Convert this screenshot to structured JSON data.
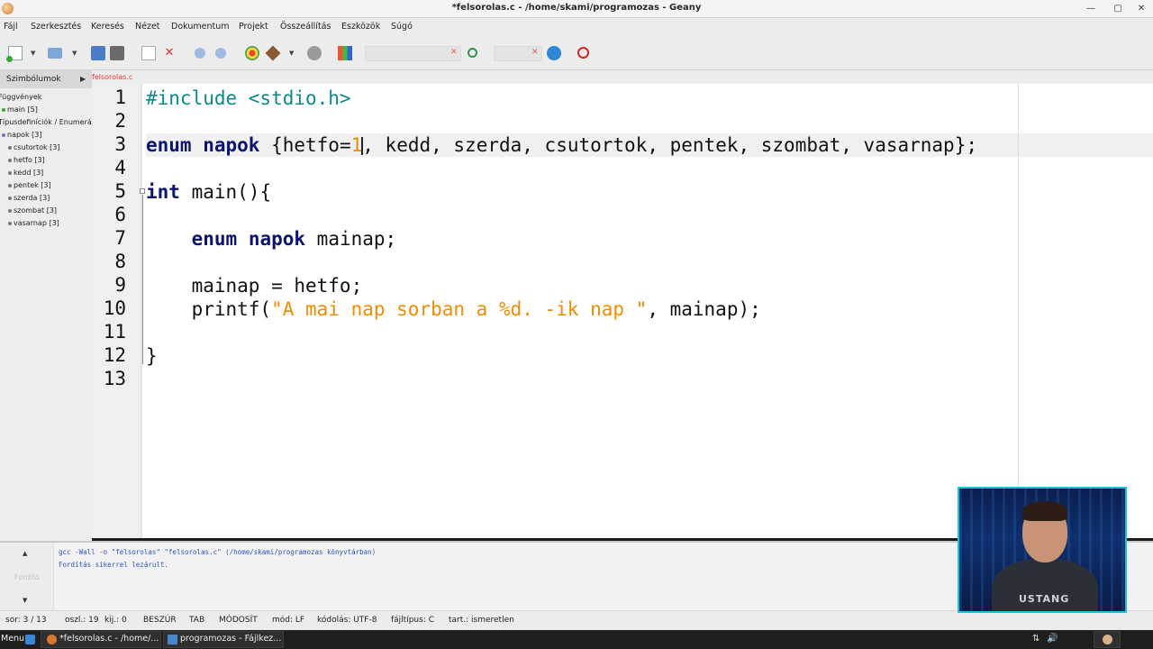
{
  "window": {
    "title": "*felsorolas.c - /home/skami/programozas - Geany",
    "controls": {
      "minimize": "—",
      "maximize": "▢",
      "close": "✕"
    }
  },
  "menu": [
    "Fájl",
    "Szerkesztés",
    "Keresés",
    "Nézet",
    "Dokumentum",
    "Projekt",
    "Összeállítás",
    "Eszközök",
    "Súgó"
  ],
  "toolbar": {
    "icons": [
      "new-file-icon",
      "open-file-icon",
      "save-icon",
      "save-all-icon",
      "revert-icon",
      "close-icon",
      "back-icon",
      "forward-icon",
      "compile-icon",
      "build-icon",
      "run-icon",
      "color-chooser-icon",
      "search-icon",
      "jump-to-line-icon",
      "quit-icon"
    ],
    "search_value": "",
    "goto_value": ""
  },
  "sidebar": {
    "tab_label": "Szimbólumok",
    "symbols": [
      {
        "label": "Függvények",
        "indent": 0,
        "kind": "group"
      },
      {
        "label": "main [5]",
        "indent": 1,
        "kind": "fn"
      },
      {
        "label": "Típusdefiníciók / Enumerá",
        "indent": 0,
        "kind": "group"
      },
      {
        "label": "napok [3]",
        "indent": 1,
        "kind": "en"
      },
      {
        "label": "csutortok [3]",
        "indent": 2,
        "kind": "mem"
      },
      {
        "label": "hetfo [3]",
        "indent": 2,
        "kind": "mem"
      },
      {
        "label": "kedd [3]",
        "indent": 2,
        "kind": "mem"
      },
      {
        "label": "pentek [3]",
        "indent": 2,
        "kind": "mem"
      },
      {
        "label": "szerda [3]",
        "indent": 2,
        "kind": "mem"
      },
      {
        "label": "szombat [3]",
        "indent": 2,
        "kind": "mem"
      },
      {
        "label": "vasarnap [3]",
        "indent": 2,
        "kind": "mem"
      }
    ]
  },
  "editor": {
    "tab_label": "felsorolas.c",
    "current_line": 3,
    "lines": [
      [
        {
          "t": "#include <stdio.h>",
          "c": "pp"
        }
      ],
      [],
      [
        {
          "t": "enum",
          "c": "kw"
        },
        {
          "t": " "
        },
        {
          "t": "napok",
          "c": "kw"
        },
        {
          "t": " {hetfo="
        },
        {
          "t": "1",
          "c": "st"
        },
        {
          "caret": true
        },
        {
          "t": ", kedd, szerda, csutortok, pentek, szombat, vasarnap};"
        }
      ],
      [],
      [
        {
          "t": "int",
          "c": "kw"
        },
        {
          "t": " main(){"
        }
      ],
      [],
      [
        {
          "t": "    "
        },
        {
          "t": "enum",
          "c": "kw"
        },
        {
          "t": " "
        },
        {
          "t": "napok",
          "c": "kw"
        },
        {
          "t": " mainap;"
        }
      ],
      [],
      [
        {
          "t": "    mainap = hetfo;"
        }
      ],
      [
        {
          "t": "    printf("
        },
        {
          "t": "\"A mai nap sorban a %d. -ik nap \"",
          "c": "st"
        },
        {
          "t": ", mainap);"
        }
      ],
      [],
      [
        {
          "t": "}"
        }
      ],
      []
    ]
  },
  "messages": {
    "tab_label": "Fordító",
    "lines": [
      "gcc -Wall -o \"felsorolas\" \"felsorolas.c\" (/home/skami/programozas könyvtárban)",
      "Fordítás sikerrel lezárult."
    ]
  },
  "status": {
    "line": "sor: 3 / 13",
    "col": "oszl.: 19",
    "sel": "kij.: 0",
    "mode": "BESZÚR",
    "indent": "TAB",
    "modified": "MÓDOSÍT",
    "eol": "mód: LF",
    "encoding": "kódolás: UTF-8",
    "filetype": "fájltípus: C",
    "scope": "tart.: ismeretlen"
  },
  "taskbar": {
    "menu": "Menu",
    "tasks": [
      "*felsorolas.c - /home/...",
      "programozas - Fájlkez..."
    ]
  },
  "webcam": {
    "shirt_text": "USTANG"
  },
  "colors": {
    "keyword": "#0b1470",
    "preprocessor": "#0a8a8a",
    "string": "#f08c00",
    "message_text": "#2a56c6",
    "tab_label": "#e33333",
    "webcam_border": "#11c7d8"
  }
}
